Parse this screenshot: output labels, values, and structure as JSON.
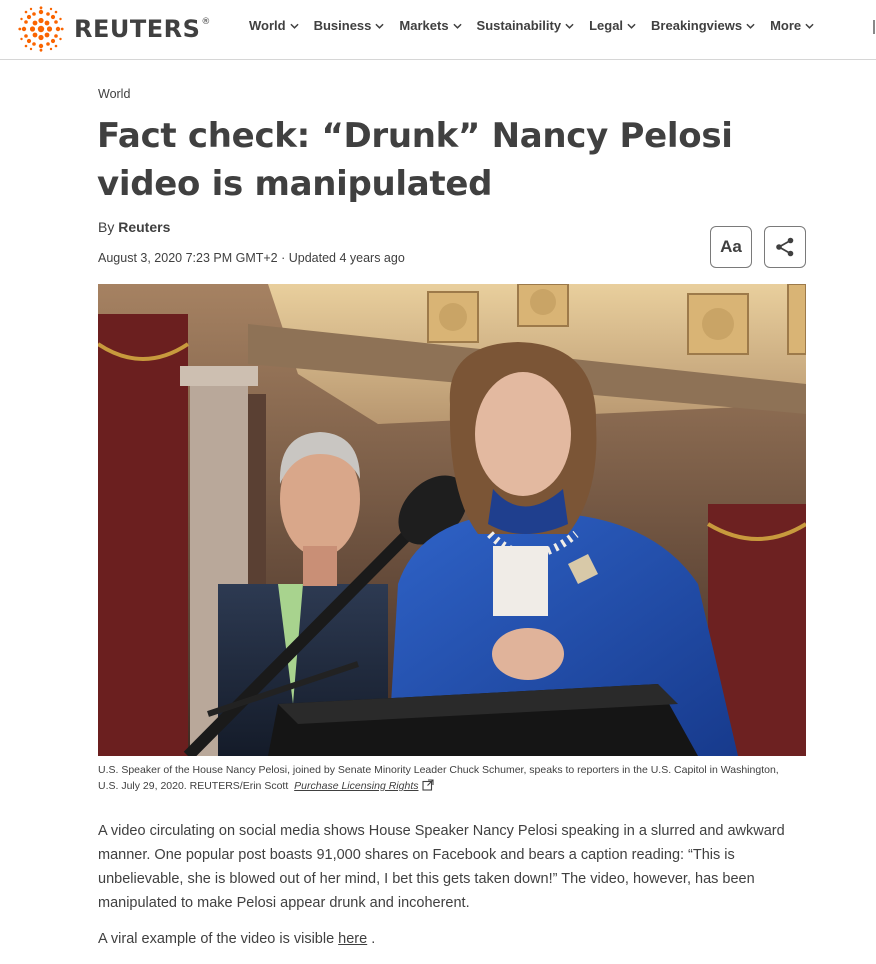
{
  "brand": {
    "name": "REUTERS",
    "registered": "®",
    "accent": "#fa6400"
  },
  "nav": {
    "items": [
      {
        "label": "World"
      },
      {
        "label": "Business"
      },
      {
        "label": "Markets"
      },
      {
        "label": "Sustainability"
      },
      {
        "label": "Legal"
      },
      {
        "label": "Breakingviews"
      },
      {
        "label": "More"
      }
    ]
  },
  "article": {
    "section": "World",
    "headline": "Fact check: “Drunk” Nancy Pelosi video is manipulated",
    "byline_prefix": "By ",
    "author": "Reuters",
    "dateline": "August 3, 2020 7:23 PM GMT+2 · Updated 4 years ago",
    "text_size_label": "Aa",
    "share_icon": "share-icon",
    "image_alt": "Nancy Pelosi and Chuck Schumer speaking to reporters in the U.S. Capitol",
    "caption": "U.S. Speaker of the House Nancy Pelosi, joined by Senate Minority Leader Chuck Schumer, speaks to reporters in the U.S. Capitol in Washington, U.S. July 29, 2020. REUTERS/Erin Scott",
    "caption_link": "Purchase Licensing Rights",
    "paragraphs": [
      "A video circulating on social media shows House Speaker Nancy Pelosi speaking in a slurred and awkward manner. One popular post boasts 91,000 shares on Facebook and bears a caption reading: “This is unbelievable, she is blowed out of her mind, I bet this gets taken down!” The video, however, has been manipulated to make Pelosi appear drunk and incoherent."
    ],
    "p2_text": "A viral example of the video is visible ",
    "p2_link": "here",
    "p2_end": " ."
  }
}
